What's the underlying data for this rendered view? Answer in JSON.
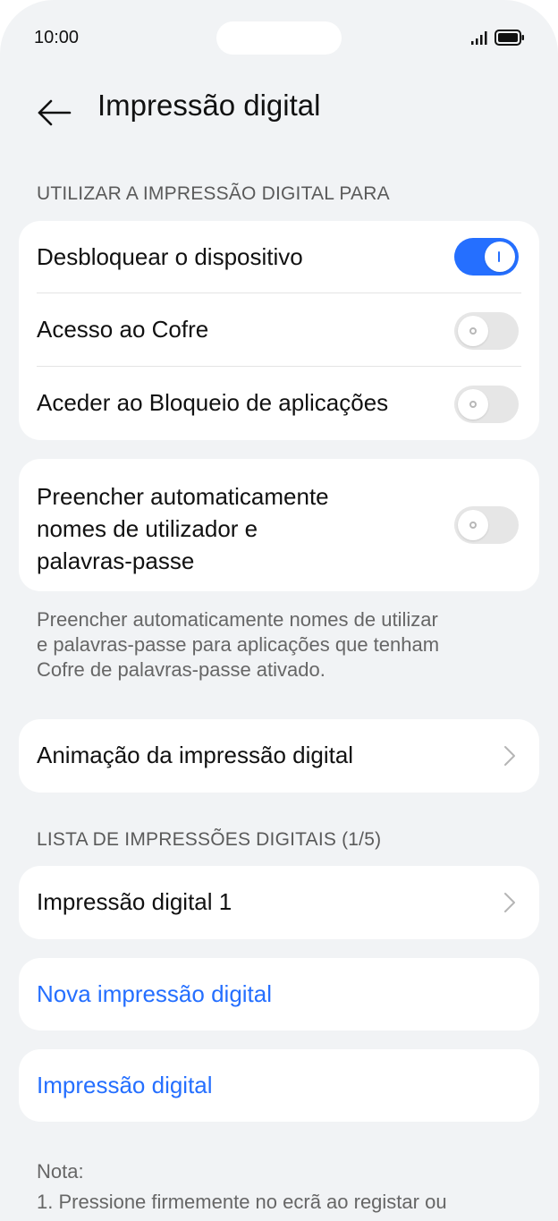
{
  "status_bar": {
    "time": "10:00"
  },
  "header": {
    "title": "Impressão digital"
  },
  "usage_section": {
    "header": "UTILIZAR A IMPRESSÃO DIGITAL PARA",
    "items": [
      {
        "label": "Desbloquear o dispositivo",
        "enabled": true
      },
      {
        "label": "Acesso ao Cofre",
        "enabled": false
      },
      {
        "label": "Aceder ao Bloqueio de aplicações",
        "enabled": false
      }
    ]
  },
  "autofill": {
    "label_line1": "Preencher automaticamente",
    "label_line2": "nomes de utilizador e",
    "label_line3": "palavras-passe",
    "enabled": false,
    "description_line1": "Preencher automaticamente nomes de utilizar",
    "description_line2": "e palavras-passe para aplicações que tenham",
    "description_line3": "Cofre de palavras-passe ativado."
  },
  "animation_item": {
    "label": "Animação da impressão digital"
  },
  "fingerprint_list": {
    "header": "LISTA DE IMPRESSÕES DIGITAIS (1/5)",
    "items": [
      {
        "label": "Impressão digital 1"
      }
    ]
  },
  "actions": {
    "new_fingerprint": "Nova impressão digital",
    "fingerprint": "Impressão digital"
  },
  "note": {
    "title": "Nota:",
    "line1": "1. Pressione firmemente no ecrã ao registar ou"
  },
  "colors": {
    "accent": "#256fff",
    "background": "#f1f3f5",
    "card": "#ffffff"
  }
}
